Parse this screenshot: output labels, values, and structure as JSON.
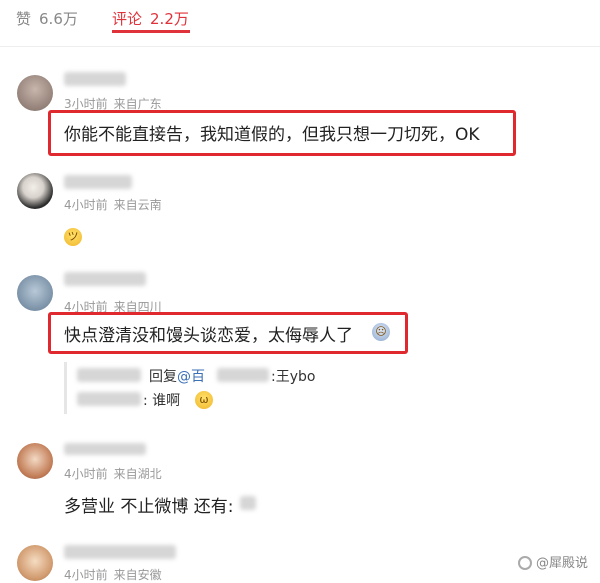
{
  "tabs": {
    "likes_label": "赞",
    "likes_count": "6.6万",
    "comments_label": "评论",
    "comments_count": "2.2万"
  },
  "comments": [
    {
      "time": "3小时前",
      "location": "来自广东",
      "text": "你能不能直接告，我知道假的，但我只想一刀切死，OK"
    },
    {
      "time": "4小时前",
      "location": "来自云南",
      "text": "",
      "emoji": "smirk-emoji"
    },
    {
      "time": "4小时前",
      "location": "来自四川",
      "text": "快点澄清没和馒头谈恋爱，太侮辱人了",
      "emoji": "sob-emoji",
      "replies": [
        {
          "prefix": "回复",
          "mention": "@百",
          "suffix": ":王ybo"
        },
        {
          "text": ": 谁啊",
          "emoji": "cat-emoji"
        }
      ]
    },
    {
      "time": "4小时前",
      "location": "来自湖北",
      "text": "多营业 不止微博 还有:"
    },
    {
      "time": "4小时前",
      "location": "来自安徽"
    }
  ],
  "watermark": "@犀殿说",
  "colors": {
    "accent": "#e0323a",
    "highlight_box": "#e0282f",
    "meta": "#999999",
    "link": "#3b6fb6"
  }
}
